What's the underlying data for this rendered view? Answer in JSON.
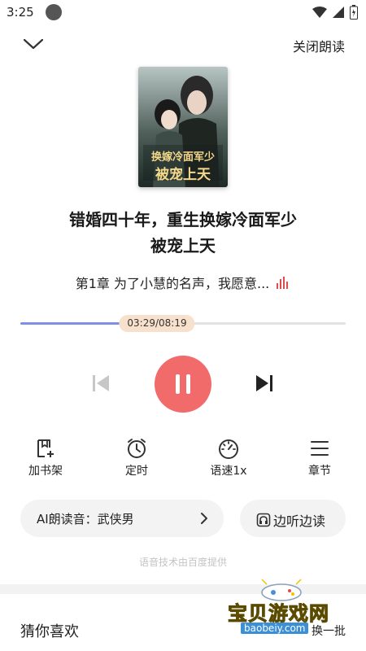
{
  "status_bar": {
    "time": "3:25",
    "icons": [
      "wifi-icon",
      "signal-icon",
      "battery-icon"
    ]
  },
  "top_bar": {
    "close_label": "关闭朗读",
    "collapse_icon": "chevron-down-icon"
  },
  "book": {
    "title_line1": "错婚四十年，重生换嫁冷面军少",
    "title_line2": "被宠上天",
    "cover_text_1": "换嫁冷面军少",
    "cover_text_2": "被宠上天"
  },
  "chapter": {
    "text": "第1章 为了小慧的名声，我愿意...",
    "playing_icon": "sound-wave-icon"
  },
  "progress": {
    "time_label": "03:29/08:19",
    "fraction": 0.42
  },
  "controls": {
    "prev_icon": "skip-previous-icon",
    "play_icon": "pause-icon",
    "next_icon": "skip-next-icon"
  },
  "actions": [
    {
      "label": "加书架",
      "icon": "add-to-shelf-icon"
    },
    {
      "label": "定时",
      "icon": "alarm-clock-icon"
    },
    {
      "label": "语速1x",
      "icon": "speedometer-icon"
    },
    {
      "label": "章节",
      "icon": "menu-lines-icon"
    }
  ],
  "voice": {
    "label": "AI朗读音：武侠男"
  },
  "listen_read": {
    "label": "边听边读"
  },
  "credit": "语音技术由百度提供",
  "recommend": {
    "title": "猜你喜欢",
    "refresh_label": "换一批"
  },
  "watermark": {
    "text": "宝贝游戏网",
    "url": "baobeiy.com"
  },
  "colors": {
    "accent_red": "#f16b6b",
    "progress_blue": "#7f8fe6",
    "thumb_beige": "#f7e1cc",
    "pill_gray": "#f3f3f3"
  }
}
